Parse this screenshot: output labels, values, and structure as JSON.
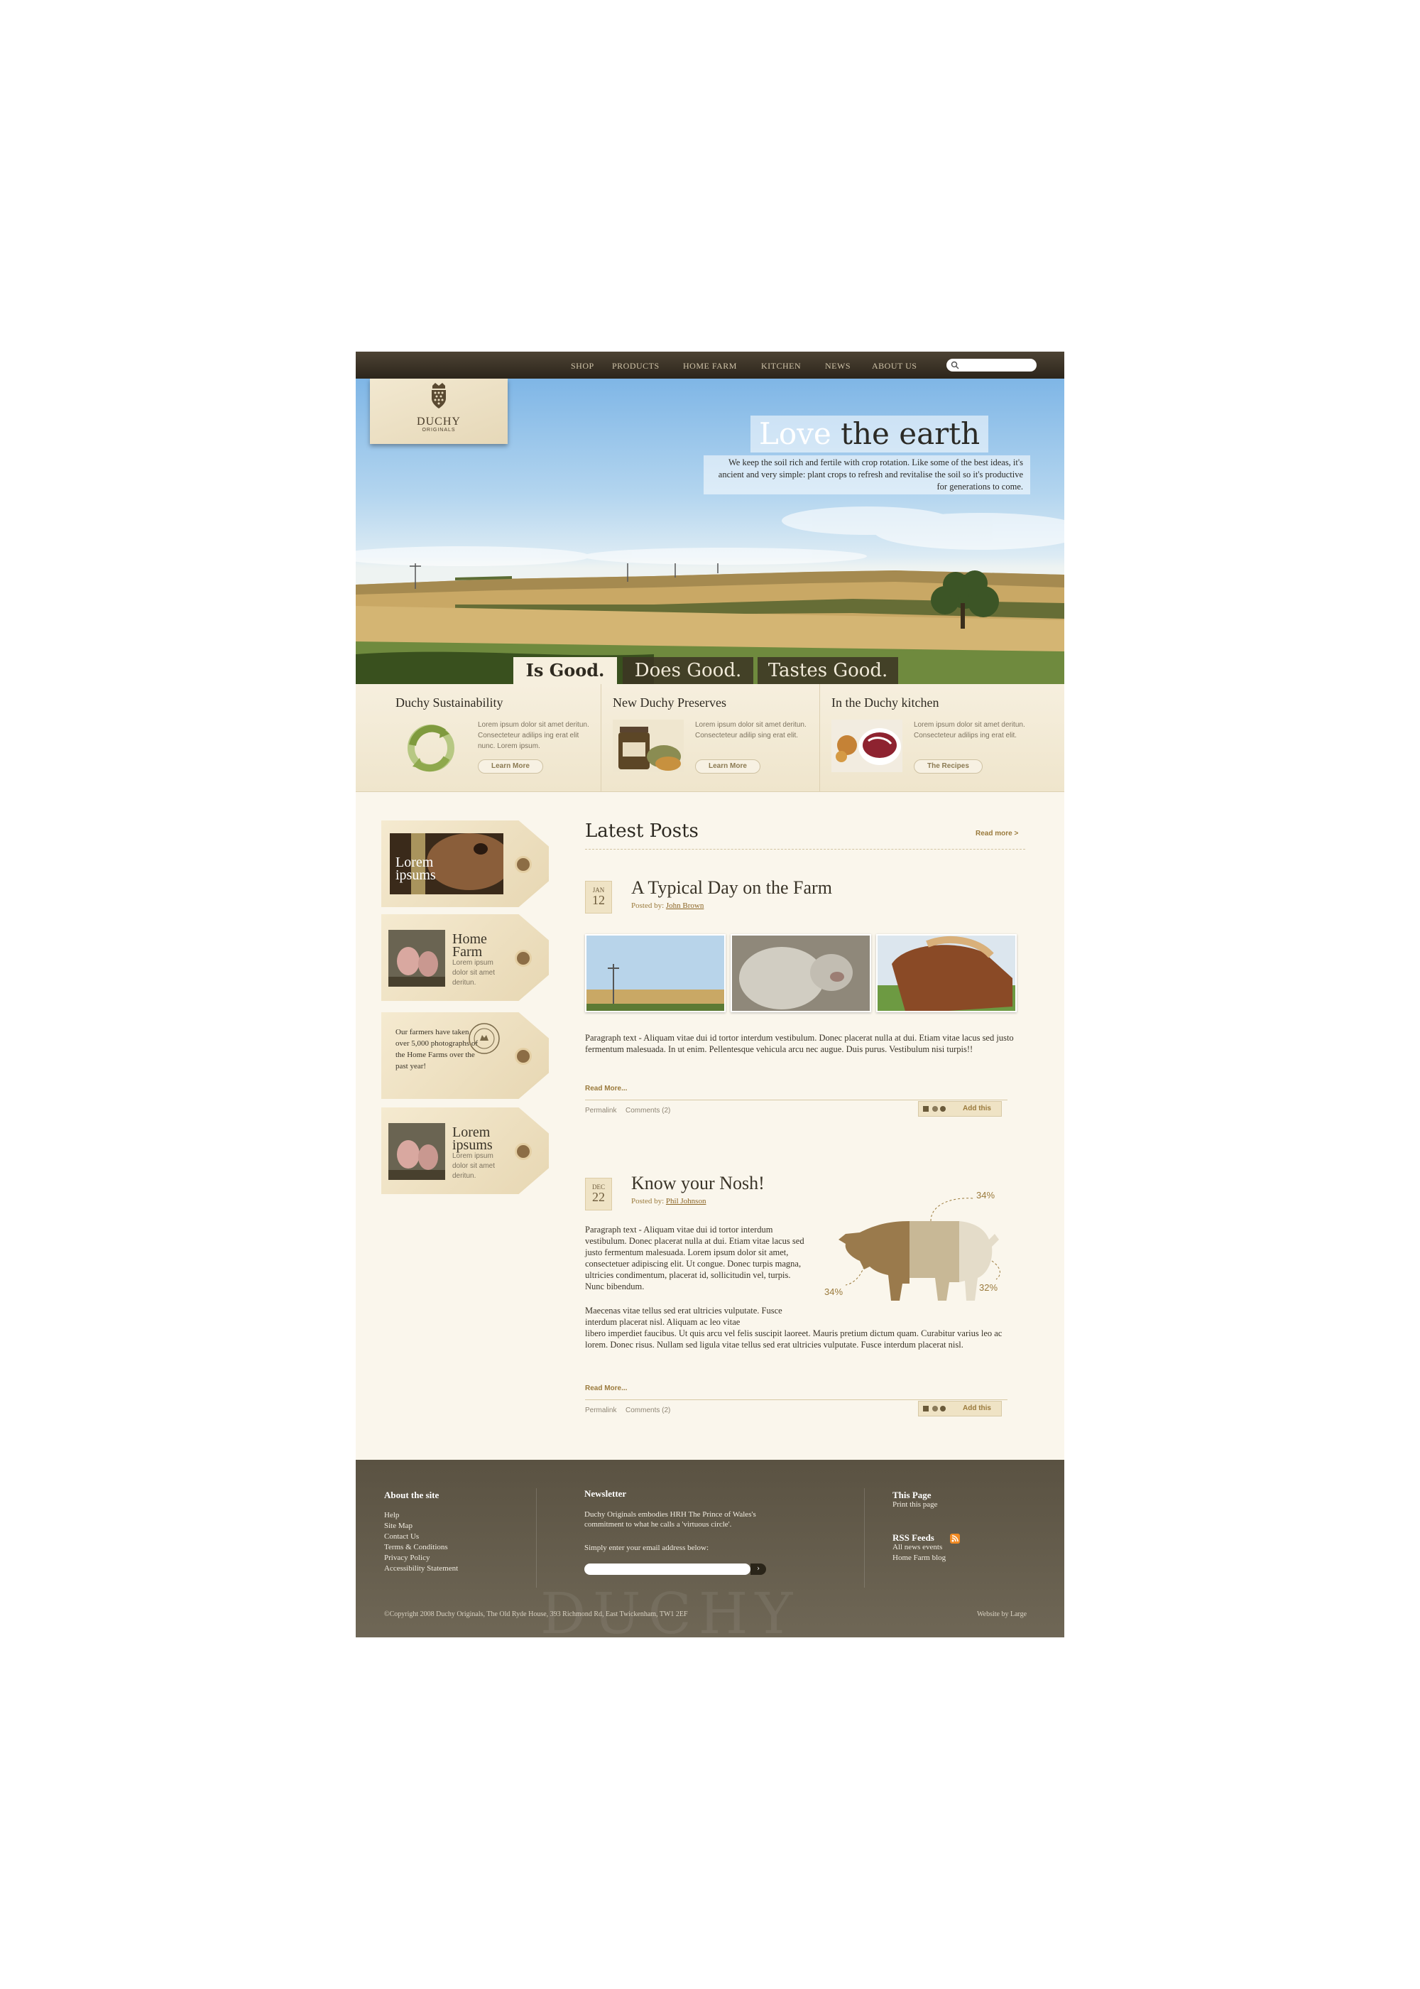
{
  "nav": {
    "items": [
      "SHOP",
      "PRODUCTS",
      "HOME FARM",
      "KITCHEN",
      "NEWS",
      "ABOUT US"
    ],
    "search_placeholder": ""
  },
  "brand": {
    "name": "DUCHY",
    "sub": "ORIGINALS"
  },
  "hero": {
    "title_word1": "Love",
    "title_rest": "the earth",
    "copy": "We keep the soil rich and fertile with crop rotation. Like some of the best ideas, it's ancient and very simple: plant crops to refresh and revitalise the soil so it's productive for generations to come.",
    "tabs": [
      "Is Good.",
      "Does Good.",
      "Tastes Good."
    ]
  },
  "features": [
    {
      "title": "Duchy Sustainability",
      "text": "Lorem ipsum dolor sit amet deritun. Consecteteur adilips ing erat elit  nunc. Lorem ipsum.",
      "button": "Learn More"
    },
    {
      "title": "New Duchy Preserves",
      "text": "Lorem ipsum dolor sit amet deritun. Consecteteur adilip sing erat elit.",
      "button": "Learn More"
    },
    {
      "title": "In the Duchy kitchen",
      "text": "Lorem ipsum dolor sit amet deritun. Consecteteur adilips ing erat elit.",
      "button": "The Recipes"
    }
  ],
  "sidebar": {
    "tags": [
      {
        "title": "Lorem ipsums",
        "body": ""
      },
      {
        "title": "Home Farm",
        "body": "Lorem ipsum dolor sit amet deritun."
      },
      {
        "title": "",
        "body": "Our farmers have taken over 5,000 photographs of the Home Farms over the past year!"
      },
      {
        "title": "Lorem ipsums",
        "body": "Lorem ipsum dolor sit amet deritun."
      }
    ],
    "seal": "THE PRINCE OF WALES"
  },
  "posts": {
    "heading": "Latest Posts",
    "read_more": "Read more >",
    "items": [
      {
        "month": "JAN",
        "day": "12",
        "title": "A Typical Day on the Farm",
        "posted_by": "Posted by:",
        "author": "John Brown",
        "para": "Paragraph text - Aliquam vitae dui id tortor interdum vestibulum. Donec placerat nulla at dui. Etiam vitae lacus sed justo fermentum malesuada. In ut enim. Pellentesque vehicula arcu nec augue. Duis purus. Vestibulum nisi turpis!!",
        "read_more": "Read More...",
        "permalink": "Permalink",
        "comments": "Comments (2)",
        "addthis": "Add this"
      },
      {
        "month": "DEC",
        "day": "22",
        "title": "Know your Nosh!",
        "posted_by": "Posted by:",
        "author": "Phil Johnson",
        "para1": "Paragraph text - Aliquam vitae dui id tortor interdum vestibulum. Donec placerat nulla at dui. Etiam vitae lacus sed justo fermentum malesuada. Lorem ipsum dolor sit amet, consectetuer adipiscing elit. Ut congue. Donec turpis magna, ultricies condimentum, placerat id, sollicitudin vel, turpis. Nunc bibendum.",
        "para2a": "Maecenas vitae tellus sed erat ultricies vulputate. Fusce interdum placerat nisl. Aliquam ac leo vitae",
        "para2b": "libero imperdiet faucibus. Ut quis arcu vel felis suscipit laoreet. Mauris pretium dictum quam. Curabitur varius leo ac lorem. Donec risus. Nullam sed ligula vitae tellus sed erat ultricies vulputate. Fusce interdum placerat nisl.",
        "read_more": "Read More...",
        "permalink": "Permalink",
        "comments": "Comments (2)",
        "addthis": "Add this",
        "pig_labels": [
          "34%",
          "34%",
          "32%"
        ]
      }
    ]
  },
  "footer": {
    "about_heading": "About the site",
    "links": [
      "Help",
      "Site Map",
      "Contact Us",
      "Terms & Conditions",
      "Privacy Policy",
      "Accessibility Statement"
    ],
    "newsletter_heading": "Newsletter",
    "newsletter_text": "Duchy Originals embodies HRH The Prince of Wales's commitment to what he calls a 'virtuous circle'.",
    "newsletter_prompt": "Simply enter your email address below:",
    "submit": "›",
    "this_page_heading": "This Page",
    "print": "Print this page",
    "rss_heading": "RSS Feeds",
    "rss_links": [
      "All news events",
      "Home Farm blog"
    ],
    "watermark": "DUCHY",
    "copyright": "©Copyright 2008 Duchy Originals, The Old Ryde House, 393 Richmond Rd, East Twickenham, TW1 2EF",
    "credit": "Website by Large"
  },
  "colors": {
    "accent": "#9a7a3c",
    "footer": "#5a5242",
    "nav": "#2c251b"
  }
}
